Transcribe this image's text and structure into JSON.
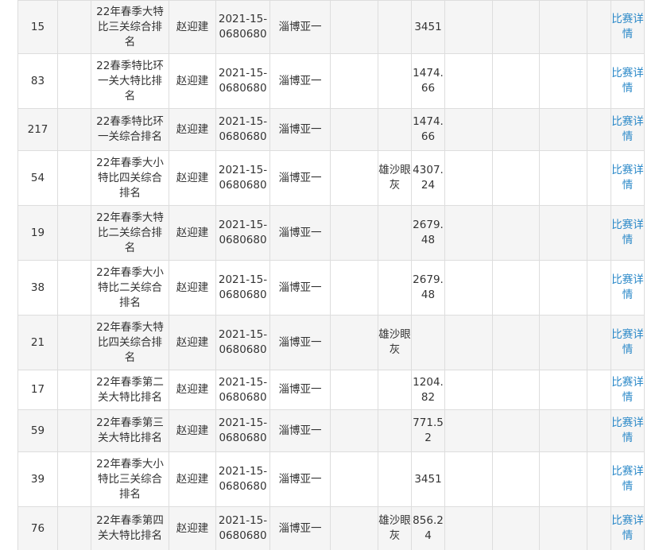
{
  "table": {
    "link_label": "比赛详情",
    "rows": [
      {
        "rank": "15",
        "blank": "",
        "name": "22年春季大特比三关综合排名",
        "owner": "赵迎建",
        "ring": "2021-15-0680680",
        "club": "淄博亚一",
        "c6": "",
        "color": "",
        "speed": "3451"
      },
      {
        "rank": "83",
        "blank": "",
        "name": "22春季特比环一关大特比排名",
        "owner": "赵迎建",
        "ring": "2021-15-0680680",
        "club": "淄博亚一",
        "c6": "",
        "color": "",
        "speed": "1474.66"
      },
      {
        "rank": "217",
        "blank": "",
        "name": "22春季特比环一关综合排名",
        "owner": "赵迎建",
        "ring": "2021-15-0680680",
        "club": "淄博亚一",
        "c6": "",
        "color": "",
        "speed": "1474.66"
      },
      {
        "rank": "54",
        "blank": "",
        "name": "22年春季大小特比四关综合排名",
        "owner": "赵迎建",
        "ring": "2021-15-0680680",
        "club": "淄博亚一",
        "c6": "",
        "color": "雄沙眼灰",
        "speed": "4307.24"
      },
      {
        "rank": "19",
        "blank": "",
        "name": "22年春季大特比二关综合排名",
        "owner": "赵迎建",
        "ring": "2021-15-0680680",
        "club": "淄博亚一",
        "c6": "",
        "color": "",
        "speed": "2679.48"
      },
      {
        "rank": "38",
        "blank": "",
        "name": "22年春季大小特比二关综合排名",
        "owner": "赵迎建",
        "ring": "2021-15-0680680",
        "club": "淄博亚一",
        "c6": "",
        "color": "",
        "speed": "2679.48"
      },
      {
        "rank": "21",
        "blank": "",
        "name": "22年春季大特比四关综合排名",
        "owner": "赵迎建",
        "ring": "2021-15-0680680",
        "club": "淄博亚一",
        "c6": "",
        "color": "雄沙眼灰",
        "speed": ""
      },
      {
        "rank": "17",
        "blank": "",
        "name": "22年春季第二关大特比排名",
        "owner": "赵迎建",
        "ring": "2021-15-0680680",
        "club": "淄博亚一",
        "c6": "",
        "color": "",
        "speed": "1204.82"
      },
      {
        "rank": "59",
        "blank": "",
        "name": "22年春季第三关大特比排名",
        "owner": "赵迎建",
        "ring": "2021-15-0680680",
        "club": "淄博亚一",
        "c6": "",
        "color": "",
        "speed": "771.52"
      },
      {
        "rank": "39",
        "blank": "",
        "name": "22年春季大小特比三关综合排名",
        "owner": "赵迎建",
        "ring": "2021-15-0680680",
        "club": "淄博亚一",
        "c6": "",
        "color": "",
        "speed": "3451"
      },
      {
        "rank": "76",
        "blank": "",
        "name": "22年春季第四关大特比排名",
        "owner": "赵迎建",
        "ring": "2021-15-0680680",
        "club": "淄博亚一",
        "c6": "",
        "color": "雄沙眼灰",
        "speed": "856.24"
      }
    ]
  }
}
